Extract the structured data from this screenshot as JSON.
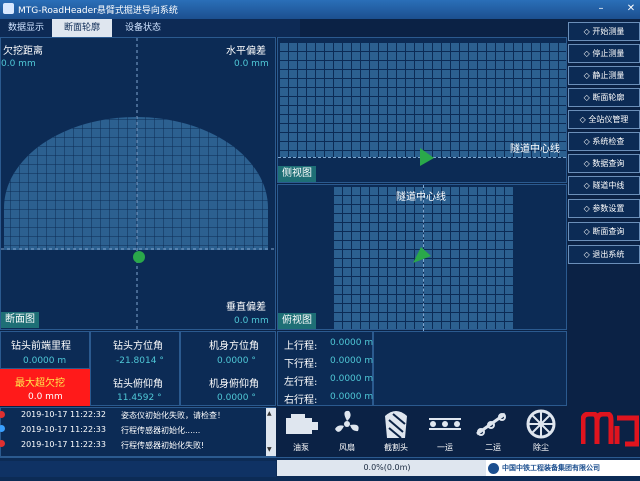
{
  "window": {
    "title": "MTG-RoadHeader悬臂式掘进导向系统"
  },
  "tabs": [
    {
      "label": "数据显示"
    },
    {
      "label": "断面轮廓"
    },
    {
      "label": "设备状态"
    }
  ],
  "main_view": {
    "top_left_label": "欠挖距离",
    "top_left_value": "0.0 mm",
    "top_right_label": "水平偏差",
    "top_right_value": "0.0 mm",
    "bottom_right_label": "垂直偏差",
    "bottom_right_value": "0.0 mm",
    "view_tag": "断面图"
  },
  "side_view": {
    "centerline": "隧道中心线",
    "tag": "侧视图"
  },
  "top_view": {
    "centerline": "隧道中心线",
    "tag": "俯视图"
  },
  "readouts": {
    "front_mileage_label": "钻头前端里程",
    "front_mileage_value": "0.0000 m",
    "max_overcut_label": "最大超欠挖",
    "max_overcut_value": "0.0 mm",
    "head_azimuth_label": "钻头方位角",
    "head_azimuth_value": "-21.8014 °",
    "head_pitch_label": "钻头俯仰角",
    "head_pitch_value": "11.4592 °",
    "body_azimuth_label": "机身方位角",
    "body_azimuth_value": "0.0000 °",
    "body_pitch_label": "机身俯仰角",
    "body_pitch_value": "0.0000 °"
  },
  "travel": [
    {
      "label": "上行程:",
      "value": "0.0000 m"
    },
    {
      "label": "下行程:",
      "value": "0.0000 m"
    },
    {
      "label": "左行程:",
      "value": "0.0000 m"
    },
    {
      "label": "右行程:",
      "value": "0.0000 m"
    }
  ],
  "menu": [
    {
      "label": "◇ 开始测量"
    },
    {
      "label": "◇ 停止测量"
    },
    {
      "label": "◇ 静止测量"
    },
    {
      "label": "◇ 断面轮廓"
    },
    {
      "label": "◇ 全站仪管理"
    },
    {
      "label": "◇ 系统检查"
    },
    {
      "label": "◇ 数据查询"
    },
    {
      "label": "◇ 隧道中线"
    },
    {
      "label": "◇ 参数设置"
    },
    {
      "label": "◇ 断面查询"
    },
    {
      "label": "◇ 退出系统"
    }
  ],
  "log": [
    {
      "time": "2019-10-17 11:22:32",
      "msg": "姿态仪初始化失败，请检查！"
    },
    {
      "time": "2019-10-17 11:22:33",
      "msg": "行程传感器初始化......"
    },
    {
      "time": "2019-10-17 11:22:33",
      "msg": "行程传感器初始化失败!"
    }
  ],
  "devices": [
    {
      "label": "油泵"
    },
    {
      "label": "风扇"
    },
    {
      "label": "截割头"
    },
    {
      "label": "一运"
    },
    {
      "label": "二运"
    },
    {
      "label": "除尘"
    }
  ],
  "status": {
    "progress": "0.0%(0.0m)",
    "company": "中国中铁工程装备集团有限公司"
  },
  "colors": {
    "background": "#0b2245",
    "grid": "#2c6090",
    "accent": "#4fc7d6",
    "alarm": "#ff1a1a",
    "marker": "#2aa84a"
  }
}
